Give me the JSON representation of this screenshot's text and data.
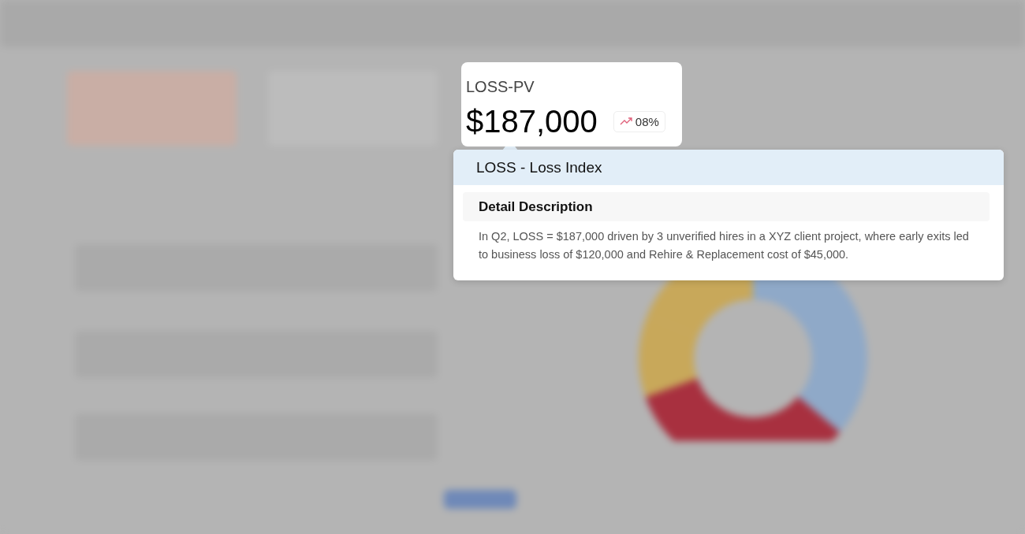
{
  "metric_card": {
    "label": "LOSS-PV",
    "value": "$187,000",
    "change": "08%"
  },
  "tooltip": {
    "title": "LOSS - Loss Index",
    "section_title": "Detail Description",
    "description": "In Q2, LOSS = $187,000 driven by 3 unverified hires in a XYZ client project, where early exits led to business loss of $120,000 and Rehire & Replacement cost of $45,000."
  }
}
